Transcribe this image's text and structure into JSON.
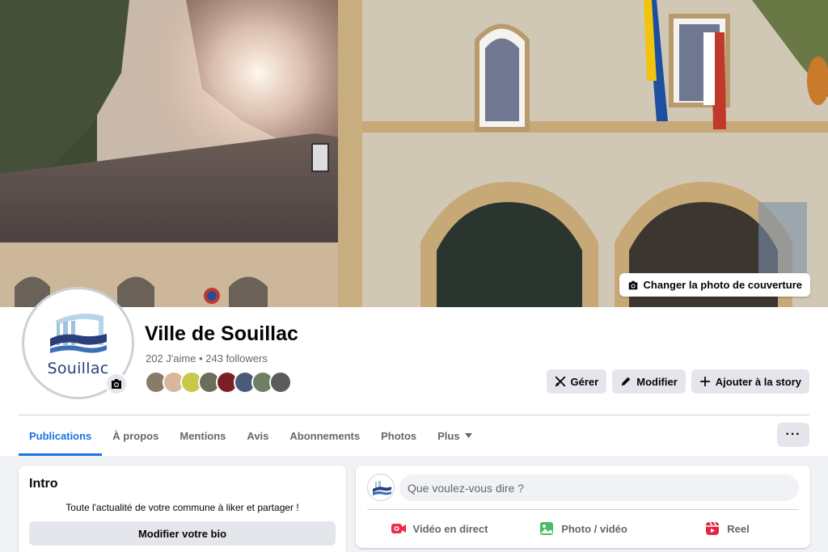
{
  "cover": {
    "change_label": "Changer la photo de couverture",
    "change_icon": "camera-icon"
  },
  "profile": {
    "logo_text": "Souillac",
    "camera_icon": "camera-icon",
    "name": "Ville de Souillac",
    "stats": "202 J'aime • 243 followers",
    "follower_faces": [
      "#8a7a68",
      "#d9b79a",
      "#c8c84a",
      "#6b6e5c",
      "#7a2024",
      "#4a5a78",
      "#6f7f62",
      "#5b5b5b"
    ]
  },
  "actions": [
    {
      "label": "Gérer",
      "icon": "manage-icon"
    },
    {
      "label": "Modifier",
      "icon": "pencil-icon"
    },
    {
      "label": "Ajouter à la story",
      "icon": "plus-icon"
    }
  ],
  "tabs": [
    {
      "label": "Publications",
      "active": true
    },
    {
      "label": "À propos",
      "active": false
    },
    {
      "label": "Mentions",
      "active": false
    },
    {
      "label": "Avis",
      "active": false
    },
    {
      "label": "Abonnements",
      "active": false
    },
    {
      "label": "Photos",
      "active": false
    },
    {
      "label": "Plus",
      "active": false
    }
  ],
  "more_button": "···",
  "intro": {
    "title": "Intro",
    "description": "Toute l'actualité de votre commune à liker et partager !",
    "edit_bio": "Modifier votre bio"
  },
  "composer": {
    "placeholder": "Que voulez-vous dire ?",
    "actions": [
      {
        "label": "Vidéo en direct",
        "icon": "live-video-icon",
        "color": "#f02849"
      },
      {
        "label": "Photo / vidéo",
        "icon": "photo-icon",
        "color": "#45bd62"
      },
      {
        "label": "Reel",
        "icon": "reel-icon",
        "color": "#e42645"
      }
    ]
  },
  "colors": {
    "accent": "#1b74e4",
    "button_bg": "#e4e6eb",
    "page_bg": "#f0f2f5"
  }
}
